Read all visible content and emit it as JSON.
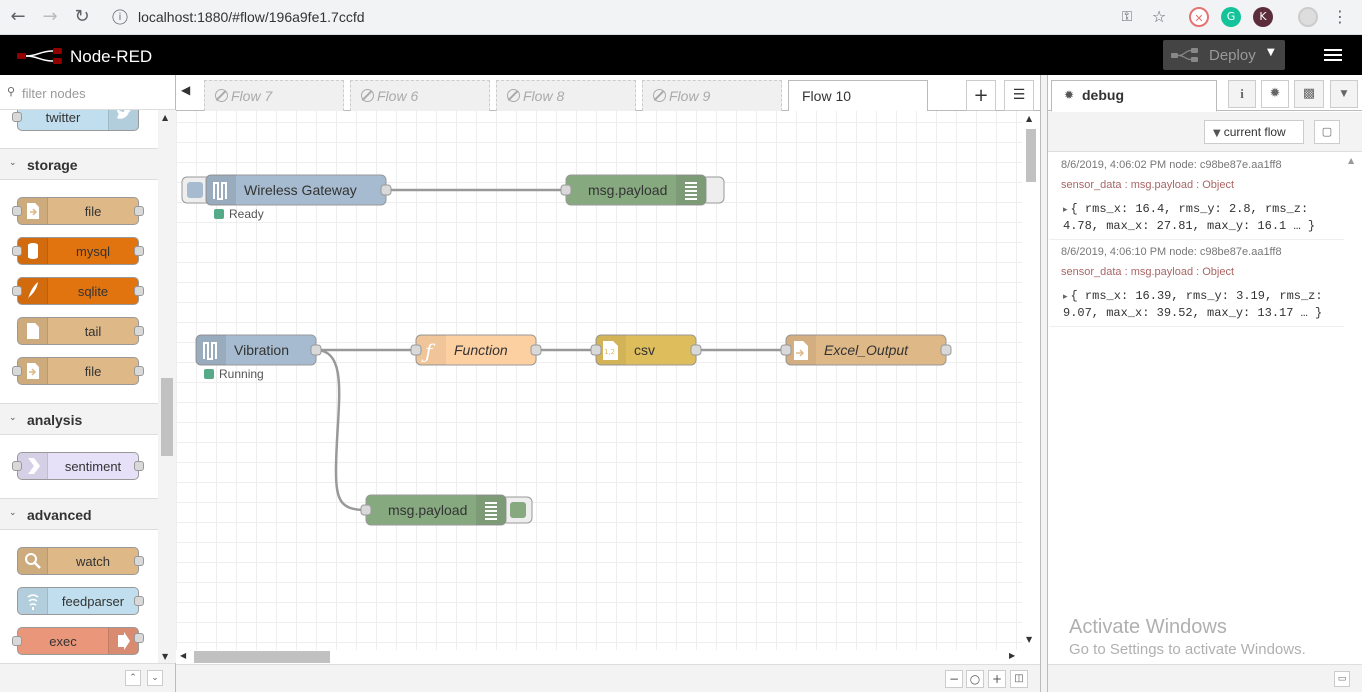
{
  "browser": {
    "url": "localhost:1880/#flow/196a9fe1.7ccfd",
    "profile_initial": "K"
  },
  "header": {
    "app_title": "Node-RED",
    "deploy_label": "Deploy"
  },
  "palette": {
    "search_placeholder": "filter nodes",
    "top_partial_node": {
      "label": "twitter",
      "color": "#c0deed"
    },
    "categories": [
      {
        "label": "storage",
        "nodes": [
          {
            "label": "file",
            "color": "#deb887",
            "icon": "file-out-icon"
          },
          {
            "label": "mysql",
            "color": "#e2740f",
            "icon": "database-icon"
          },
          {
            "label": "sqlite",
            "color": "#e2740f",
            "icon": "feather-icon"
          },
          {
            "label": "tail",
            "color": "#deb887",
            "icon": "file-icon"
          },
          {
            "label": "file",
            "color": "#deb887",
            "icon": "file-in-icon"
          }
        ]
      },
      {
        "label": "analysis",
        "nodes": [
          {
            "label": "sentiment",
            "color": "#e6e0f8",
            "icon": "arrow-icon"
          }
        ]
      },
      {
        "label": "advanced",
        "nodes": [
          {
            "label": "watch",
            "color": "#deb887",
            "icon": "magnifier-icon"
          },
          {
            "label": "feedparser",
            "color": "#c0deed",
            "icon": "feed-icon"
          },
          {
            "label": "exec",
            "color": "#e9967a",
            "icon": "arrow-right-icon"
          }
        ]
      }
    ]
  },
  "tabs": [
    {
      "label": "Flow 7",
      "disabled": true
    },
    {
      "label": "Flow 6",
      "disabled": true
    },
    {
      "label": "Flow 8",
      "disabled": true
    },
    {
      "label": "Flow 9",
      "disabled": true
    },
    {
      "label": "Flow 10",
      "disabled": false,
      "active": true
    }
  ],
  "flow": {
    "nodes": {
      "gateway": {
        "label": "Wireless Gateway",
        "status": "Ready",
        "status_color": "#5a8"
      },
      "debug1": {
        "label": "msg.payload"
      },
      "vibration": {
        "label": "Vibration",
        "status": "Running",
        "status_color": "#5a8"
      },
      "function": {
        "label": "Function"
      },
      "csv": {
        "label": "csv"
      },
      "excel": {
        "label": "Excel_Output"
      },
      "debug2": {
        "label": "msg.payload"
      }
    },
    "colors": {
      "gateway": "#a6bbcf",
      "debug": "#87a980",
      "function": "#fdd0a2",
      "csv": "#debd5c",
      "file": "#deb887"
    }
  },
  "sidebar": {
    "tab_label": "debug",
    "filter_label": "current flow",
    "messages": [
      {
        "meta": "8/6/2019, 4:06:02 PM   node: c98be87e.aa1ff8",
        "topic": "sensor_data : msg.payload : Object",
        "line1": "{ rms_x: 16.4, rms_y: 2.8, rms_z:",
        "line2": "4.78, max_x: 27.81, max_y: 16.1 … }"
      },
      {
        "meta": "8/6/2019, 4:06:10 PM   node: c98be87e.aa1ff8",
        "topic": "sensor_data : msg.payload : Object",
        "line1": "{ rms_x: 16.39, rms_y: 3.19, rms_z:",
        "line2": "9.07, max_x: 39.52, max_y: 13.17 … }"
      }
    ]
  },
  "watermark": {
    "title": "Activate Windows",
    "subtitle": "Go to Settings to activate Windows."
  }
}
